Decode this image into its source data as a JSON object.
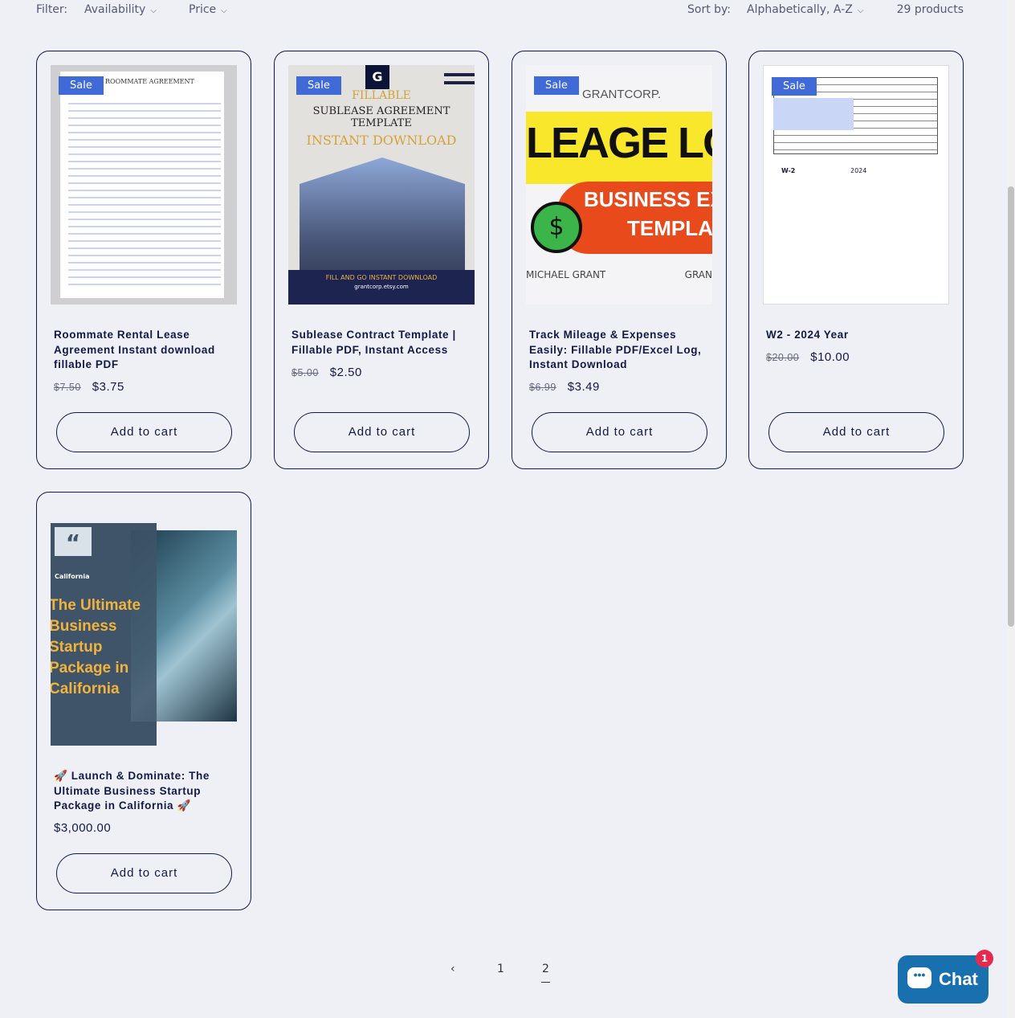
{
  "filter": {
    "label": "Filter:",
    "availability": "Availability",
    "price": "Price"
  },
  "sort": {
    "label": "Sort by:",
    "value": "Alphabetically, A-Z",
    "count": "29 products"
  },
  "products": [
    {
      "title": "Roommate Rental Lease Agreement Instant download fillable PDF",
      "old_price": "$7.50",
      "price": "$3.75",
      "badge": "Sale",
      "button": "Add to cart",
      "image_text": "ROOMMATE AGREEMENT"
    },
    {
      "title": "Sublease Contract Template | Fillable PDF, Instant Access",
      "old_price": "$5.00",
      "price": "$2.50",
      "badge": "Sale",
      "button": "Add to cart",
      "image_text": [
        "FILLABLE",
        "SUBLEASE AGREEMENT TEMPLATE",
        "INSTANT DOWNLOAD",
        "FILL AND GO INSTANT DOWNLOAD",
        "grantcorp.etsy.com"
      ]
    },
    {
      "title": "Track Mileage & Expenses Easily: Fillable PDF/Excel Log, Instant Download",
      "old_price": "$6.99",
      "price": "$3.49",
      "badge": "Sale",
      "button": "Add to cart",
      "image_text": [
        "GRANTCORP.",
        "LEAGE LO",
        "BUSINESS EX",
        "TEMPLA",
        "MICHAEL GRANT",
        "GRAN"
      ]
    },
    {
      "title": "W2 - 2024 Year",
      "old_price": "$20.00",
      "price": "$10.00",
      "badge": "Sale",
      "button": "Add to cart",
      "image_text": [
        "W-2",
        "2024"
      ]
    },
    {
      "title": "🚀 Launch & Dominate: The Ultimate Business Startup Package in California 🚀",
      "old_price": "",
      "price": "$3,000.00",
      "badge": "",
      "button": "Add to cart",
      "image_text": [
        "California",
        "The Ultimate Business Startup Package in California"
      ]
    }
  ],
  "pagination": {
    "prev": "‹",
    "pages": [
      "1",
      "2"
    ],
    "current": "2"
  },
  "chat": {
    "label": "Chat",
    "badge": "1"
  },
  "colors": {
    "background": "#eef0f6",
    "accent": "#121a45",
    "sale": "#3f6ad8",
    "chat": "#1870ae"
  }
}
